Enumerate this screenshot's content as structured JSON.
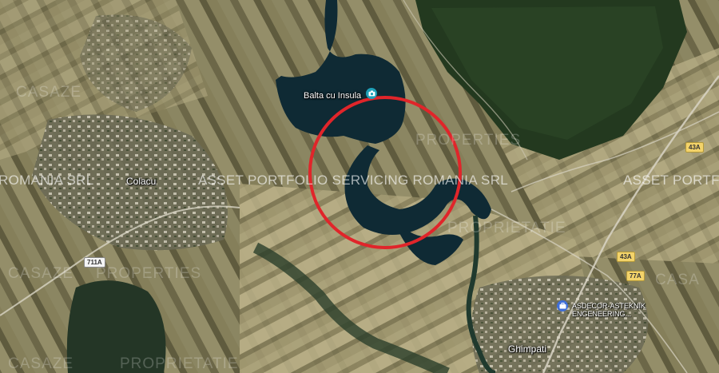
{
  "labels": {
    "lake": "Balta cu Insula",
    "town1": "Colacu",
    "town2": "Ghimpati",
    "business_line1": "ASDECOR-ASTEKNIK",
    "business_line2": "ENGENEERING..."
  },
  "watermarks": {
    "left": "ROMANIA SRL",
    "center": "ASSET PORTFOLIO SERVICING ROMANIA SRL",
    "right": "ASSET PORTFO",
    "casa": "CASAZE",
    "proprietatie": "PROPRIETATIE",
    "properties": "PROPERTIES",
    "casa_bottom": "CASA"
  },
  "road_shields": {
    "r711a": "711A",
    "r43a_top": "43A",
    "r43a_mid": "43A",
    "r77a": "77A"
  },
  "icons": {
    "lake_poi": "camera-icon",
    "business_poi": "briefcase-icon"
  },
  "colors": {
    "highlight_circle": "#e0252a",
    "lake_poi": "#1fa0b8",
    "business_poi": "#3f6ed8",
    "water": "#0f2a34"
  }
}
